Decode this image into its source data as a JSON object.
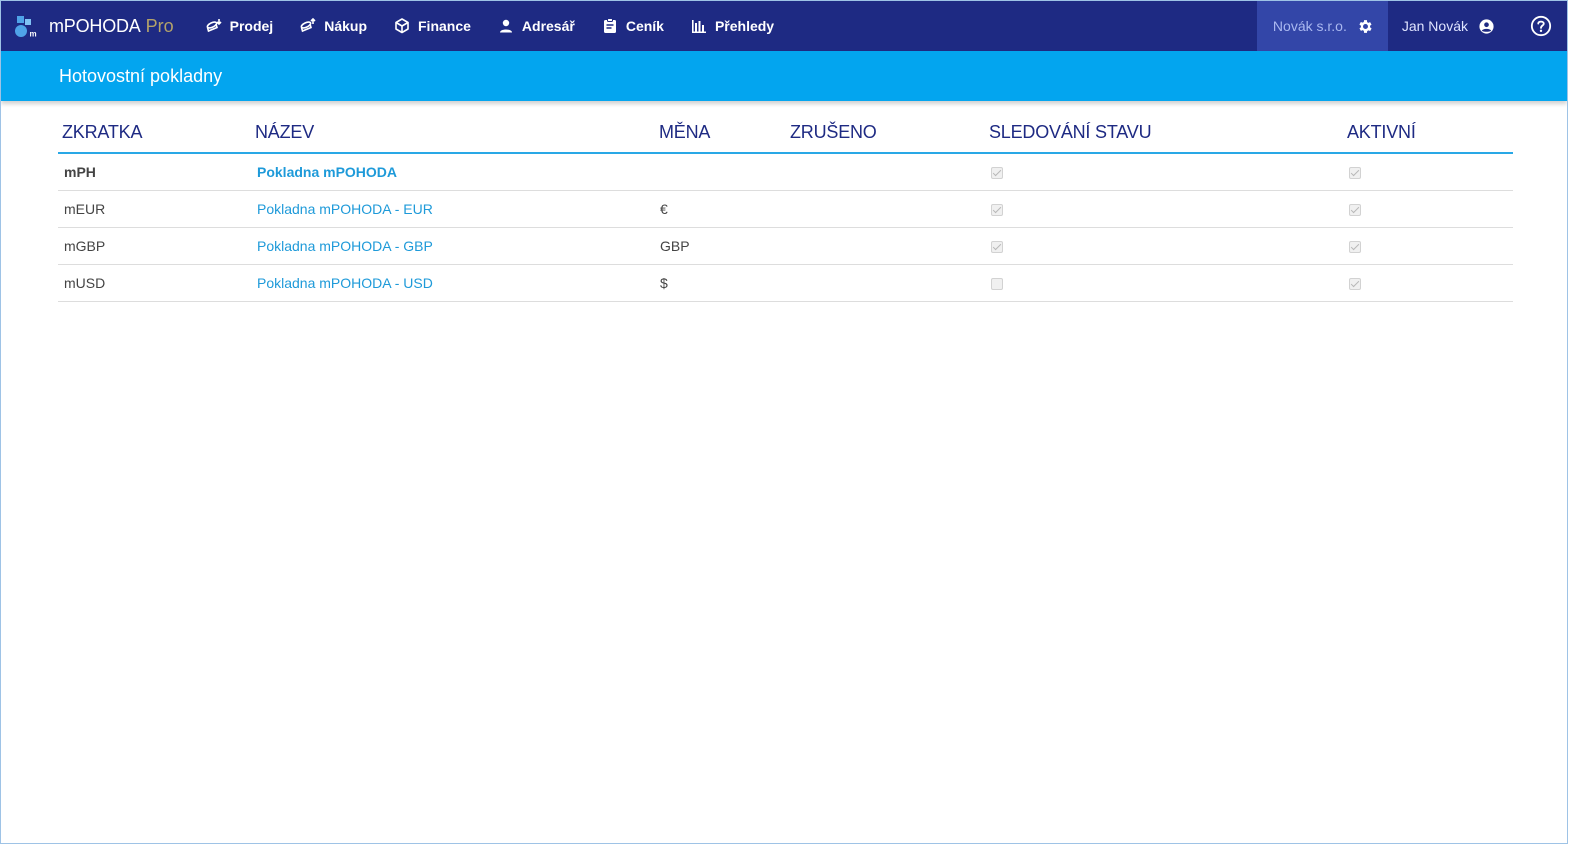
{
  "navbar": {
    "brand": "mPOHODA",
    "brand_suffix": "Pro",
    "items": [
      {
        "label": "Prodej",
        "icon": "coins-in-icon"
      },
      {
        "label": "Nákup",
        "icon": "coins-out-icon"
      },
      {
        "label": "Finance",
        "icon": "finance-cube-icon"
      },
      {
        "label": "Adresář",
        "icon": "person-icon"
      },
      {
        "label": "Ceník",
        "icon": "clipboard-icon"
      },
      {
        "label": "Přehledy",
        "icon": "bar-chart-icon"
      }
    ],
    "company": "Novák s.r.o.",
    "user": "Jan Novák"
  },
  "page": {
    "title": "Hotovostní pokladny"
  },
  "table": {
    "columns": {
      "abbr": "ZKRATKA",
      "name": "NÁZEV",
      "currency": "MĚNA",
      "cancelled": "ZRUŠENO",
      "tracking": "SLEDOVÁNÍ STAVU",
      "active": "AKTIVNÍ"
    },
    "rows": [
      {
        "abbr": "mPH",
        "name": "Pokladna mPOHODA",
        "currency": "",
        "tracking": true,
        "active": true,
        "bold": true
      },
      {
        "abbr": "mEUR",
        "name": "Pokladna mPOHODA - EUR",
        "currency": "€",
        "tracking": true,
        "active": true,
        "bold": false
      },
      {
        "abbr": "mGBP",
        "name": "Pokladna mPOHODA - GBP",
        "currency": "GBP",
        "tracking": true,
        "active": true,
        "bold": false
      },
      {
        "abbr": "mUSD",
        "name": "Pokladna mPOHODA - USD",
        "currency": "$",
        "tracking": false,
        "active": true,
        "bold": false
      }
    ]
  },
  "colors": {
    "navbar": "#1e2a83",
    "titlebar": "#03a5ef",
    "link": "#1e9ad9",
    "header_text": "#1e2a83",
    "accent": "#29a8e6"
  }
}
